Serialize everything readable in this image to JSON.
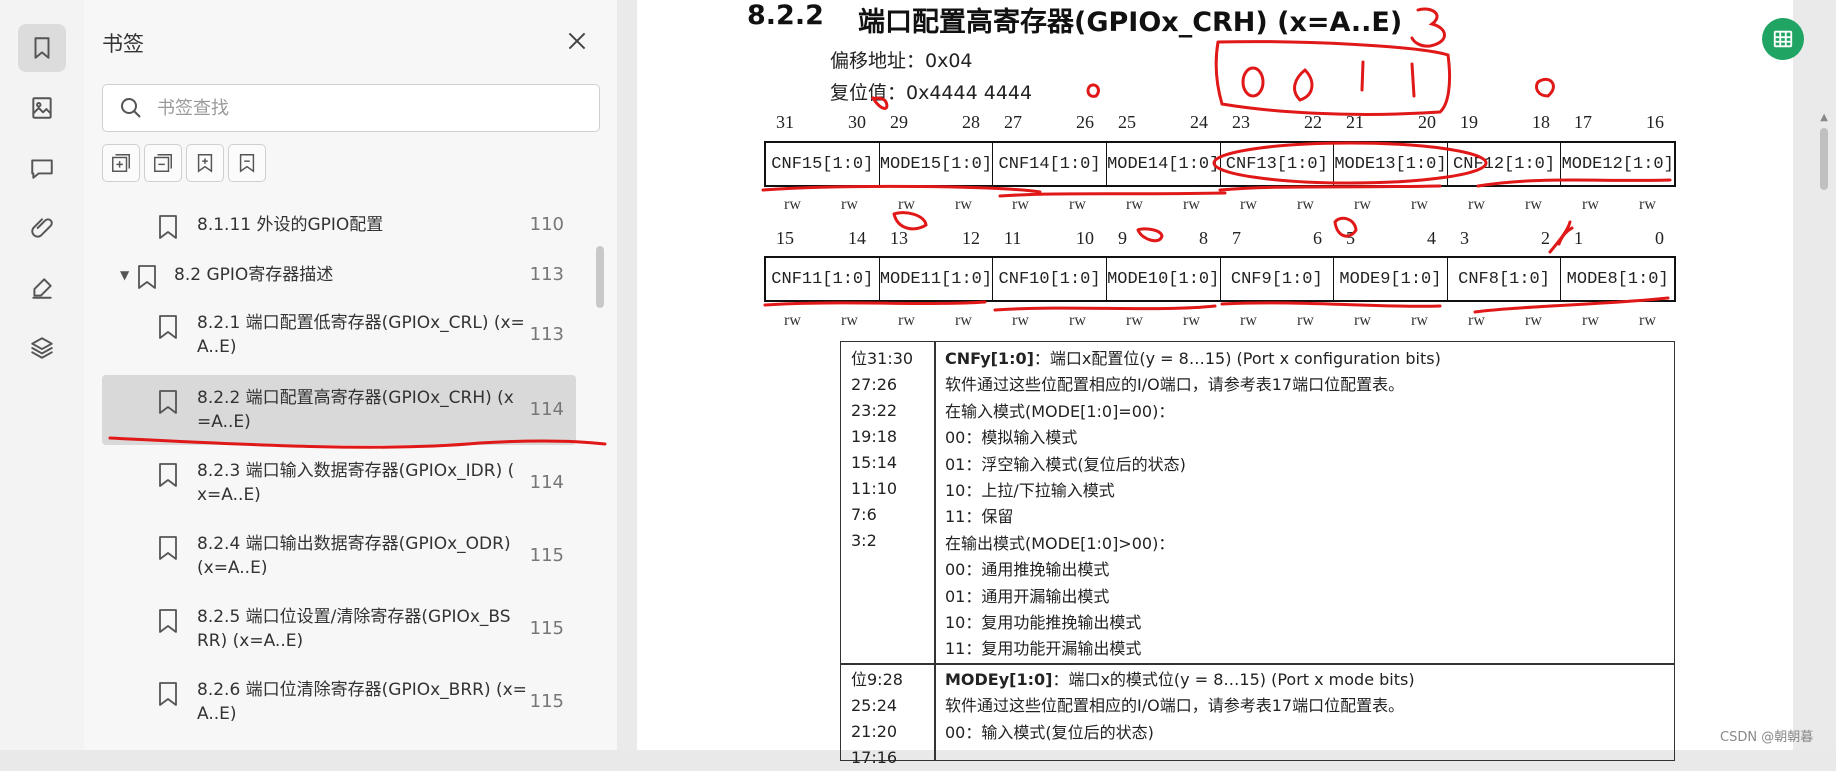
{
  "panel": {
    "title": "书签",
    "search_placeholder": "书签查找",
    "bookmarks": [
      {
        "label_lines": [
          "8.1.11 外设的GPIO配置"
        ],
        "page": "110"
      },
      {
        "label_lines": [
          "8.2 GPIO寄存器描述"
        ],
        "page": "113",
        "expanded": true
      },
      {
        "label_lines": [
          "8.2.1 端口配置低寄存器(GPIOx_CRL) (x=",
          "A..E)"
        ],
        "page": "113"
      },
      {
        "label_lines": [
          "8.2.2 端口配置高寄存器(GPIOx_CRH) (x",
          "=A..E)"
        ],
        "page": "114",
        "selected": true
      },
      {
        "label_lines": [
          "8.2.3 端口输入数据寄存器(GPIOx_IDR) (",
          "x=A..E)"
        ],
        "page": "114"
      },
      {
        "label_lines": [
          "8.2.4 端口输出数据寄存器(GPIOx_ODR)",
          "(x=A..E)"
        ],
        "page": "115"
      },
      {
        "label_lines": [
          "8.2.5 端口位设置/清除寄存器(GPIOx_BS",
          "RR) (x=A..E)"
        ],
        "page": "115"
      },
      {
        "label_lines": [
          "8.2.6 端口位清除寄存器(GPIOx_BRR) (x=",
          "A..E)"
        ],
        "page": "115"
      }
    ]
  },
  "doc": {
    "section_number": "8.2.2",
    "section_title": "端口配置高寄存器(GPIOx_CRH) (x=A..E)",
    "offset": "偏移地址：0x04",
    "reset": "复位值：0x4444 4444",
    "high_bits": [
      "31",
      "30",
      "29",
      "28",
      "27",
      "26",
      "25",
      "24",
      "23",
      "22",
      "21",
      "20",
      "19",
      "18",
      "17",
      "16"
    ],
    "low_bits": [
      "15",
      "14",
      "13",
      "12",
      "11",
      "10",
      "9",
      "8",
      "7",
      "6",
      "5",
      "4",
      "3",
      "2",
      "1",
      "0"
    ],
    "high_fields": [
      "CNF15[1:0]",
      "MODE15[1:0]",
      "CNF14[1:0]",
      "MODE14[1:0]",
      "CNF13[1:0]",
      "MODE13[1:0]",
      "CNF12[1:0]",
      "MODE12[1:0]"
    ],
    "low_fields": [
      "CNF11[1:0]",
      "MODE11[1:0]",
      "CNF10[1:0]",
      "MODE10[1:0]",
      "CNF9[1:0]",
      "MODE9[1:0]",
      "CNF8[1:0]",
      "MODE8[1:0]"
    ],
    "rw": "rw",
    "cnf_bits": [
      "位31:30",
      "27:26",
      "23:22",
      "19:18",
      "15:14",
      "11:10",
      "7:6",
      "3:2"
    ],
    "cnf_title_bold": "CNFy[1:0]",
    "cnf_title_rest": "：端口x配置位(y = 8…15) (Port x configuration bits)",
    "cnf_lines": [
      "软件通过这些位配置相应的I/O端口，请参考表17端口位配置表。",
      "在输入模式(MODE[1:0]=00)：",
      "00：模拟输入模式",
      "01：浮空输入模式(复位后的状态)",
      "10：上拉/下拉输入模式",
      "11：保留",
      "在输出模式(MODE[1:0]>00)：",
      "00：通用推挽输出模式",
      "01：通用开漏输出模式",
      "10：复用功能推挽输出模式",
      "11：复用功能开漏输出模式"
    ],
    "mode_bits": [
      "位9:28",
      "25:24",
      "21:20",
      "17:16"
    ],
    "mode_title_bold": "MODEy[1:0]",
    "mode_title_rest": "：端口x的模式位(y = 8…15) (Port x mode bits)",
    "mode_lines": [
      "软件通过这些位配置相应的I/O端口，请参考表17端口位配置表。",
      "00：输入模式(复位后的状态)"
    ]
  },
  "annotations": {
    "digit_3": "3",
    "digits_0011": "0 0 1 1"
  },
  "watermark": "CSDN @朝朝暮"
}
